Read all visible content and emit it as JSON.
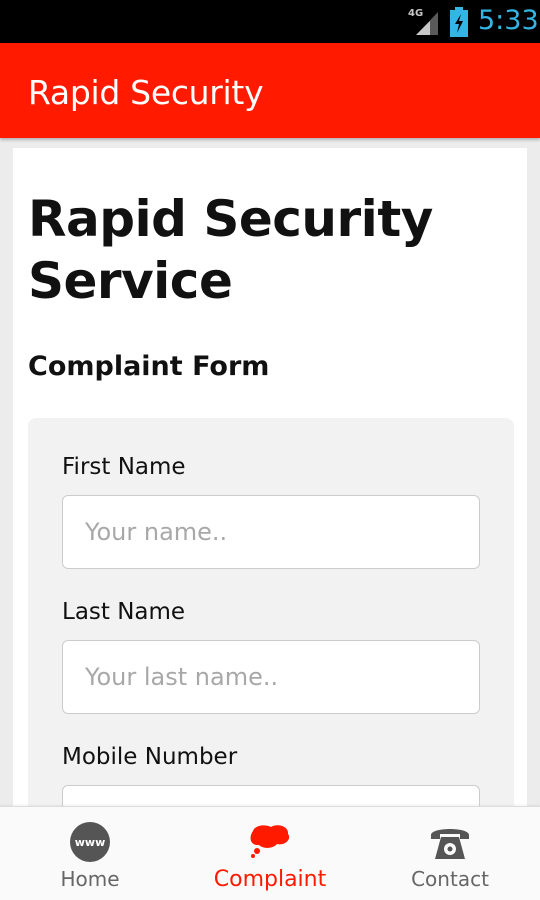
{
  "status_bar": {
    "network": "4G",
    "time": "5:33"
  },
  "app_bar": {
    "title": "Rapid Security"
  },
  "page": {
    "title": "Rapid Security Service",
    "form_heading": "Complaint Form"
  },
  "form": {
    "fields": [
      {
        "label": "First Name",
        "placeholder": "Your name..",
        "value": ""
      },
      {
        "label": "Last Name",
        "placeholder": "Your last name..",
        "value": ""
      },
      {
        "label": "Mobile Number",
        "placeholder": "",
        "value": ""
      }
    ]
  },
  "bottom_nav": {
    "items": [
      {
        "label": "Home",
        "icon": "www-globe-icon",
        "active": false
      },
      {
        "label": "Complaint",
        "icon": "complaint-speech-icon",
        "active": true
      },
      {
        "label": "Contact",
        "icon": "telephone-icon",
        "active": false
      }
    ]
  },
  "colors": {
    "accent": "#ff1a00",
    "status_text": "#33b5e5",
    "nav_inactive": "#666666",
    "icon_gray": "#555555"
  }
}
